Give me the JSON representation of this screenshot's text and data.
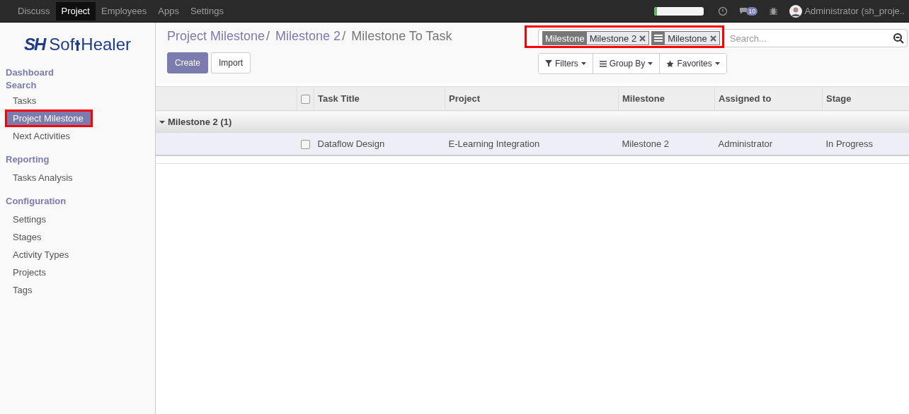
{
  "top_menu": [
    {
      "label": "Discuss",
      "selected": false
    },
    {
      "label": "Project",
      "selected": true
    },
    {
      "label": "Employees",
      "selected": false
    },
    {
      "label": "Apps",
      "selected": false
    },
    {
      "label": "Settings",
      "selected": false
    }
  ],
  "systray": {
    "progress": {
      "level": 0.05
    },
    "message_count": "10",
    "user": "Administrator (sh_proje.."
  },
  "logo": {
    "mark": "SH",
    "text_a": "Sof",
    "text_b": "Healer"
  },
  "sidebar": {
    "links": [
      "Dashboard",
      "Search"
    ],
    "groups": [
      {
        "items": [
          {
            "label": "Tasks",
            "selected": false,
            "highlighted": false
          },
          {
            "label": "Project Milestone",
            "selected": true,
            "highlighted": true
          },
          {
            "label": "Next Activities",
            "selected": false,
            "highlighted": false
          }
        ]
      },
      {
        "title": "Reporting",
        "items": [
          {
            "label": "Tasks Analysis",
            "selected": false,
            "highlighted": false
          }
        ]
      },
      {
        "title": "Configuration",
        "items": [
          {
            "label": "Settings",
            "selected": false,
            "highlighted": false
          },
          {
            "label": "Stages",
            "selected": false,
            "highlighted": false
          },
          {
            "label": "Activity Types",
            "selected": false,
            "highlighted": false
          },
          {
            "label": "Projects",
            "selected": false,
            "highlighted": false
          },
          {
            "label": "Tags",
            "selected": false,
            "highlighted": false
          }
        ]
      }
    ]
  },
  "breadcrumb": [
    {
      "label": "Project Milestone",
      "separator": "/"
    },
    {
      "label": "Milestone 2",
      "separator": "/"
    },
    {
      "label": "Milestone To Task"
    }
  ],
  "buttons": [
    "Create",
    "Import"
  ],
  "search": {
    "highlighted": true,
    "facets": [
      {
        "kind": "filter",
        "label": "Milestone",
        "value": "Milestone 2"
      },
      {
        "kind": "groupby",
        "value": "Milestone"
      }
    ],
    "placeholder": "Search..."
  },
  "search_options": [
    "Filters",
    "Group By",
    "Favorites"
  ],
  "table": {
    "all_checked": false,
    "columns": [
      "Task Title",
      "Project",
      "Milestone",
      "Assigned to",
      "Stage"
    ],
    "groups": [
      {
        "label": "Milestone 2 (1)",
        "expanded": true,
        "rows": [
          {
            "checked": false,
            "cells": [
              "Dataflow Design",
              "E-Learning Integration",
              "Milestone 2",
              "Administrator",
              "In Progress"
            ]
          }
        ]
      }
    ]
  }
}
